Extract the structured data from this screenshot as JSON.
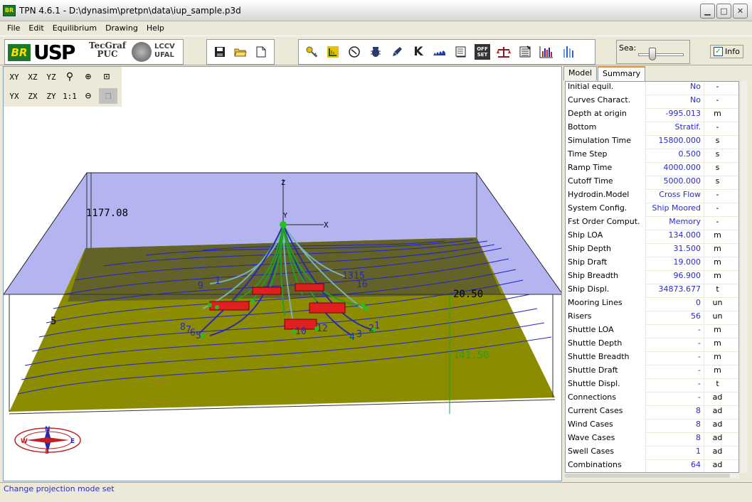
{
  "window": {
    "title": "TPN 4.6.1 - D:\\dynasim\\pretpn\\data\\iup_sample.p3d",
    "app_icon_text": "BR"
  },
  "menu": [
    "File",
    "Edit",
    "Equilibrium",
    "Drawing",
    "Help"
  ],
  "logos": {
    "br": "BR",
    "usp": "USP",
    "tecgraf_1": "TecGraf",
    "tecgraf_2": "PUC",
    "lccv_1": "LCCV",
    "lccv_2": "UFAL"
  },
  "toolbar": {
    "file_icons": [
      "save-icon",
      "open-folder-icon",
      "new-document-icon"
    ],
    "tool_icons": [
      "key-icon",
      "chart-h-icon",
      "clock-icon",
      "bug-icon",
      "pencil-icon",
      "k-icon",
      "waves-icon",
      "book-icon",
      "offset-icon",
      "balance-icon",
      "list-icon",
      "bar-chart-icon",
      "bar-chart-2-icon"
    ],
    "k_label": "K",
    "offset_label_1": "OFF",
    "offset_label_2": "SET",
    "sea_label": "Sea:",
    "info_label": "Info",
    "info_checked": true
  },
  "view_tools": {
    "row1": [
      "XY",
      "XZ",
      "YZ"
    ],
    "row2": [
      "YX",
      "ZX",
      "ZY",
      "1:1"
    ]
  },
  "scene": {
    "label_depth": "1177.08",
    "label_right": "20.50",
    "label_coord": "141.50",
    "label_left_5": "5",
    "axis_z": "Z",
    "axis_y": "Y",
    "axis_x": "X",
    "anchor_labels": [
      "9",
      "1",
      "13",
      "15",
      "16",
      "8",
      "7",
      "6",
      "5",
      "4",
      "3",
      "2",
      "1",
      "10",
      "12"
    ],
    "compass_letters": [
      "N",
      "S",
      "W",
      "E"
    ],
    "colors": {
      "sky": "#b4b4f0",
      "seabed": "#8c8c00",
      "contour": "#2222cc",
      "lines": "#22a022",
      "risers": "#78b4b4",
      "ship": "#e02020"
    }
  },
  "panel": {
    "tabs": [
      "Model",
      "Summary"
    ],
    "active_tab": "Summary",
    "rows": [
      {
        "label": "Initial equil.",
        "value": "No",
        "unit": "-"
      },
      {
        "label": "Curves Charact.",
        "value": "No",
        "unit": "-"
      },
      {
        "label": "Depth at origin",
        "value": "-995.013",
        "unit": "m"
      },
      {
        "label": "Bottom",
        "value": "Stratif.",
        "unit": "-"
      },
      {
        "label": "Simulation Time",
        "value": "15800.000",
        "unit": "s"
      },
      {
        "label": "Time Step",
        "value": "0.500",
        "unit": "s"
      },
      {
        "label": "Ramp Time",
        "value": "4000.000",
        "unit": "s"
      },
      {
        "label": "Cutoff Time",
        "value": "5000.000",
        "unit": "s"
      },
      {
        "label": "Hydrodin.Model",
        "value": "Cross Flow",
        "unit": "-"
      },
      {
        "label": "System Config.",
        "value": "Ship Moored",
        "unit": "-"
      },
      {
        "label": "Fst Order Comput.",
        "value": "Memory",
        "unit": "-"
      },
      {
        "label": "Ship LOA",
        "value": "134.000",
        "unit": "m"
      },
      {
        "label": "Ship Depth",
        "value": "31.500",
        "unit": "m"
      },
      {
        "label": "Ship Draft",
        "value": "19.000",
        "unit": "m"
      },
      {
        "label": "Ship Breadth",
        "value": "96.900",
        "unit": "m"
      },
      {
        "label": "Ship Displ.",
        "value": "34873.677",
        "unit": "t"
      },
      {
        "label": "Mooring Lines",
        "value": "0",
        "unit": "un"
      },
      {
        "label": "Risers",
        "value": "56",
        "unit": "un"
      },
      {
        "label": "Shuttle LOA",
        "value": "-",
        "unit": "m"
      },
      {
        "label": "Shuttle Depth",
        "value": "-",
        "unit": "m"
      },
      {
        "label": "Shuttle Breadth",
        "value": "-",
        "unit": "m"
      },
      {
        "label": "Shuttle Draft",
        "value": "-",
        "unit": "m"
      },
      {
        "label": "Shuttle Displ.",
        "value": "-",
        "unit": "t"
      },
      {
        "label": "Connections",
        "value": "-",
        "unit": "ad"
      },
      {
        "label": "Current Cases",
        "value": "8",
        "unit": "ad"
      },
      {
        "label": "Wind Cases",
        "value": "8",
        "unit": "ad"
      },
      {
        "label": "Wave Cases",
        "value": "8",
        "unit": "ad"
      },
      {
        "label": "Swell Cases",
        "value": "1",
        "unit": "ad"
      },
      {
        "label": "Combinations",
        "value": "64",
        "unit": "ad"
      }
    ]
  },
  "status": {
    "text": "Change projection mode set"
  }
}
